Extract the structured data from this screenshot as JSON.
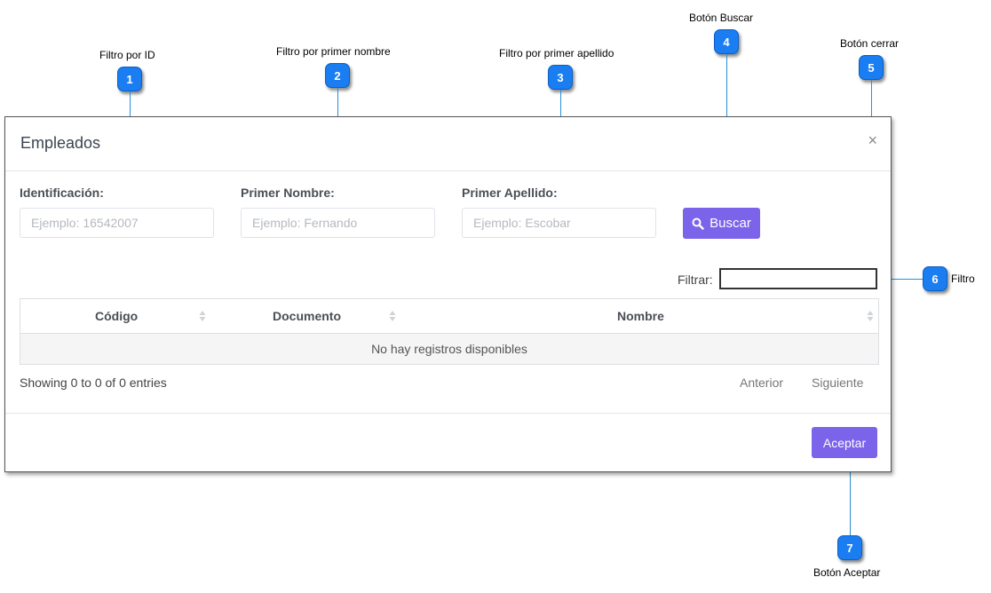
{
  "annotations": [
    {
      "num": "1",
      "label": "Filtro por ID"
    },
    {
      "num": "2",
      "label": "Filtro por primer nombre"
    },
    {
      "num": "3",
      "label": "Filtro por primer apellido"
    },
    {
      "num": "4",
      "label": "Botón  Buscar"
    },
    {
      "num": "5",
      "label": "Botón cerrar"
    },
    {
      "num": "6",
      "label": "Filtro"
    },
    {
      "num": "7",
      "label": "Botón Aceptar"
    }
  ],
  "modal": {
    "title": "Empleados",
    "close_symbol": "×",
    "fields": {
      "id": {
        "label": "Identificación:",
        "placeholder": "Ejemplo: 16542007",
        "value": ""
      },
      "first_name": {
        "label": "Primer Nombre:",
        "placeholder": "Ejemplo: Fernando",
        "value": ""
      },
      "last_name": {
        "label": "Primer Apellido:",
        "placeholder": "Ejemplo: Escobar",
        "value": ""
      }
    },
    "search_button": {
      "label": "Buscar",
      "icon": "search-icon"
    },
    "filter": {
      "label": "Filtrar:",
      "value": ""
    },
    "table": {
      "columns": [
        "Código",
        "Documento",
        "Nombre"
      ],
      "empty_message": "No hay registros disponibles"
    },
    "info": "Showing 0 to 0 of 0 entries",
    "pager": {
      "previous": "Anterior",
      "next": "Siguiente"
    },
    "accept_button": "Aceptar"
  },
  "colors": {
    "accent": "#7b63ea",
    "badge": "#1a7ef2",
    "leader": "#2a8fd6"
  }
}
